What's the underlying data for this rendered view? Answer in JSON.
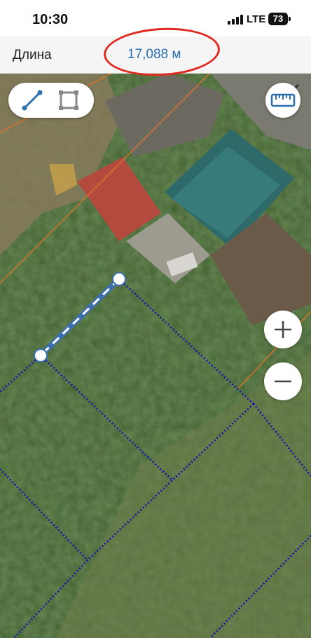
{
  "status_bar": {
    "time": "10:30",
    "network": "LTE",
    "battery": "73"
  },
  "header": {
    "label": "Длина",
    "value": "17,088 м"
  },
  "icons": {
    "close": "close-icon",
    "line_tool": "line-tool-icon",
    "area_tool": "area-tool-icon",
    "ruler": "ruler-icon",
    "zoom_in": "plus-icon",
    "zoom_out": "minus-icon"
  },
  "colors": {
    "measure_value": "#2a6fb0",
    "annotation": "#e02a1f",
    "measure_line": "#3b6fb0",
    "parcel_border": "#1a1aa8",
    "cadastral_line": "#d9722c"
  }
}
